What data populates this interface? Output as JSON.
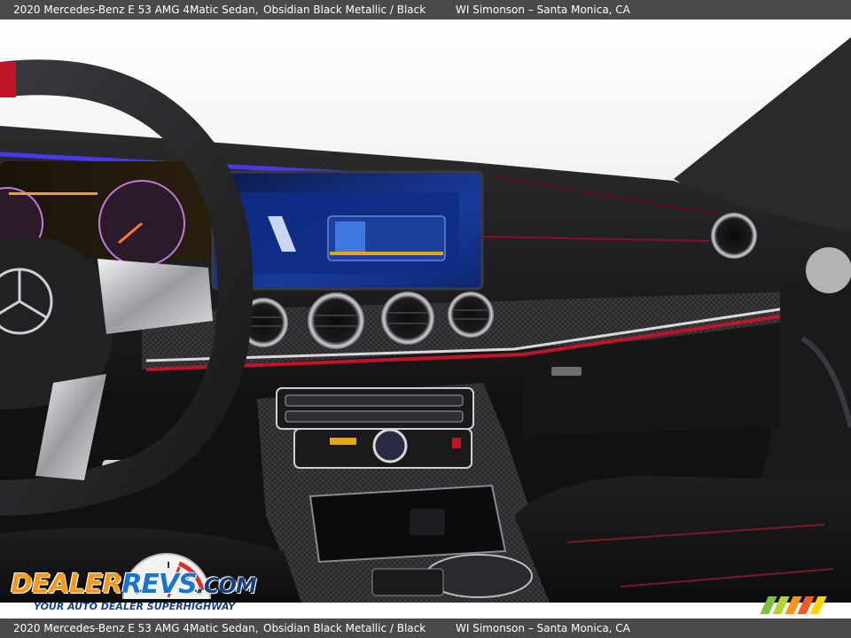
{
  "caption": {
    "title": "2020 Mercedes-Benz E 53 AMG 4Matic Sedan,",
    "color": "Obsidian Black Metallic / Black",
    "dealer": "WI Simonson – Santa Monica, CA"
  },
  "watermark": {
    "word_dealer": "DEALER",
    "word_revs": "REVS",
    "word_com": ".COM",
    "tagline": "YOUR AUTO DEALER SUPERHIGHWAY",
    "dial_icon": "speedometer-icon",
    "stripe_icon": "stripe-logo-icon"
  },
  "colors": {
    "caption_bg": "#4a4a4a",
    "ambient_light": "#4b3bff",
    "accent_red": "#c0142a",
    "logo_orange": "#f39a1c",
    "logo_blue": "#1a74c9"
  }
}
